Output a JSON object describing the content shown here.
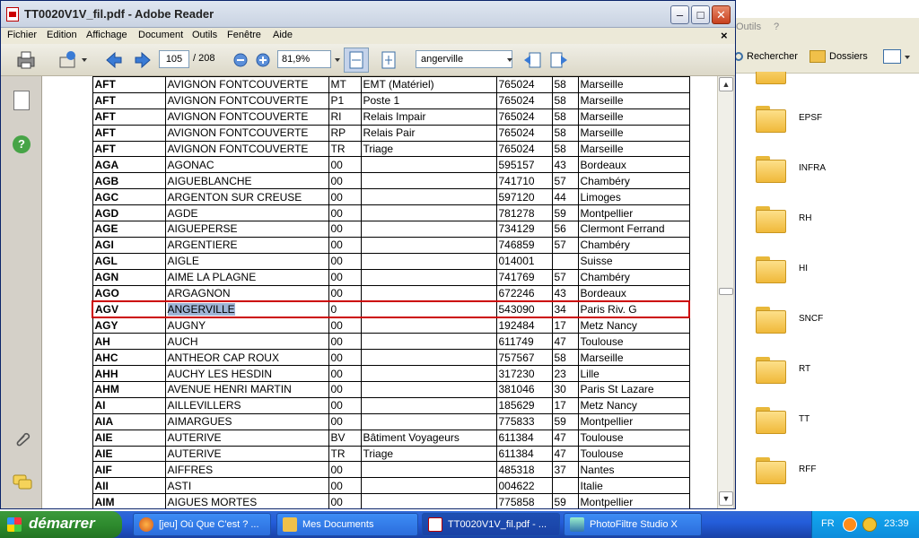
{
  "explorer": {
    "menu": [
      "Outils",
      "?"
    ],
    "search_label": "Rechercher",
    "folders_label": "Dossiers",
    "folders": [
      "EPSF",
      "INFRA",
      "RH",
      "HI",
      "SNCF",
      "RT",
      "TT",
      "RFF"
    ]
  },
  "reader": {
    "title": "TT0020V1V_fil.pdf - Adobe Reader",
    "menu": [
      "Fichier",
      "Edition",
      "Affichage",
      "Document",
      "Outils",
      "Fenêtre",
      "Aide"
    ],
    "close_doc": "×",
    "page_current": "105",
    "page_total": "/ 208",
    "zoom": "81,9%",
    "search_value": "angerville"
  },
  "table": {
    "rows": [
      [
        "AFT",
        "AVIGNON FONTCOUVERTE",
        "MT",
        "EMT (Matériel)",
        "765024",
        "58",
        "Marseille"
      ],
      [
        "AFT",
        "AVIGNON FONTCOUVERTE",
        "P1",
        "Poste 1",
        "765024",
        "58",
        "Marseille"
      ],
      [
        "AFT",
        "AVIGNON FONTCOUVERTE",
        "RI",
        "Relais Impair",
        "765024",
        "58",
        "Marseille"
      ],
      [
        "AFT",
        "AVIGNON FONTCOUVERTE",
        "RP",
        "Relais Pair",
        "765024",
        "58",
        "Marseille"
      ],
      [
        "AFT",
        "AVIGNON FONTCOUVERTE",
        "TR",
        "Triage",
        "765024",
        "58",
        "Marseille"
      ],
      [
        "AGA",
        "AGONAC",
        "00",
        "",
        "595157",
        "43",
        "Bordeaux"
      ],
      [
        "AGB",
        "AIGUEBLANCHE",
        "00",
        "",
        "741710",
        "57",
        "Chambéry"
      ],
      [
        "AGC",
        "ARGENTON SUR CREUSE",
        "00",
        "",
        "597120",
        "44",
        "Limoges"
      ],
      [
        "AGD",
        "AGDE",
        "00",
        "",
        "781278",
        "59",
        "Montpellier"
      ],
      [
        "AGE",
        "AIGUEPERSE",
        "00",
        "",
        "734129",
        "56",
        "Clermont Ferrand"
      ],
      [
        "AGI",
        "ARGENTIERE",
        "00",
        "",
        "746859",
        "57",
        "Chambéry"
      ],
      [
        "AGL",
        "AIGLE",
        "00",
        "",
        "014001",
        "",
        "Suisse"
      ],
      [
        "AGN",
        "AIME LA PLAGNE",
        "00",
        "",
        "741769",
        "57",
        "Chambéry"
      ],
      [
        "AGO",
        "ARGAGNON",
        "00",
        "",
        "672246",
        "43",
        "Bordeaux"
      ],
      [
        "AGV",
        "ANGERVILLE",
        "0",
        "",
        "543090",
        "34",
        "Paris Riv. G"
      ],
      [
        "AGY",
        "AUGNY",
        "00",
        "",
        "192484",
        "17",
        "Metz Nancy"
      ],
      [
        "AH",
        "AUCH",
        "00",
        "",
        "611749",
        "47",
        "Toulouse"
      ],
      [
        "AHC",
        "ANTHEOR CAP ROUX",
        "00",
        "",
        "757567",
        "58",
        "Marseille"
      ],
      [
        "AHH",
        "AUCHY LES HESDIN",
        "00",
        "",
        "317230",
        "23",
        "Lille"
      ],
      [
        "AHM",
        "AVENUE HENRI MARTIN",
        "00",
        "",
        "381046",
        "30",
        "Paris St Lazare"
      ],
      [
        "AI",
        "AILLEVILLERS",
        "00",
        "",
        "185629",
        "17",
        "Metz Nancy"
      ],
      [
        "AIA",
        "AIMARGUES",
        "00",
        "",
        "775833",
        "59",
        "Montpellier"
      ],
      [
        "AIE",
        "AUTERIVE",
        "BV",
        "Bâtiment Voyageurs",
        "611384",
        "47",
        "Toulouse"
      ],
      [
        "AIE",
        "AUTERIVE",
        "TR",
        "Triage",
        "611384",
        "47",
        "Toulouse"
      ],
      [
        "AIF",
        "AIFFRES",
        "00",
        "",
        "485318",
        "37",
        "Nantes"
      ],
      [
        "AII",
        "ASTI",
        "00",
        "",
        "004622",
        "",
        "Italie"
      ],
      [
        "AIM",
        "AIGUES MORTES",
        "00",
        "",
        "775858",
        "59",
        "Montpellier"
      ]
    ],
    "highlight_row": 14
  },
  "taskbar": {
    "start": "démarrer",
    "tasks": [
      {
        "label": "[jeu] Où Que C'est ? ...",
        "icon": "firefox-icon"
      },
      {
        "label": "Mes Documents",
        "icon": "folder-icon"
      },
      {
        "label": "TT0020V1V_fil.pdf - ...",
        "icon": "pdf-icon"
      },
      {
        "label": "PhotoFiltre Studio X",
        "icon": "photofiltre-icon"
      }
    ],
    "lang": "FR",
    "clock": "23:39"
  },
  "colors": {
    "highlight_border": "#cc0000",
    "selection": "#9fb4d6",
    "taskbar": "#245edb",
    "start": "#2e8b2e"
  }
}
